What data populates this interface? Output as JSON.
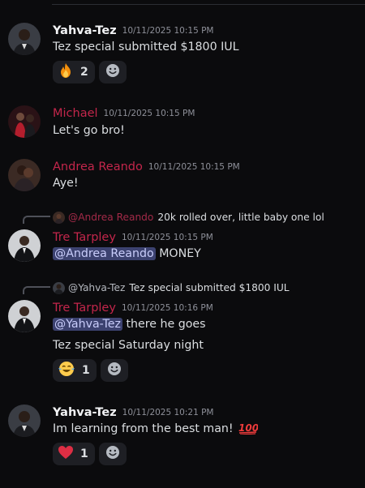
{
  "messages": [
    {
      "author": "Yahva-Tez",
      "timestamp": "10/11/2025 10:15 PM",
      "text": "Tez special submitted $1800 IUL",
      "reaction": {
        "emoji": "fire",
        "count": "2"
      }
    },
    {
      "author": "Michael",
      "timestamp": "10/11/2025 10:15 PM",
      "text": "Let's go bro!"
    },
    {
      "author": "Andrea Reando",
      "timestamp": "10/11/2025 10:15 PM",
      "text": "Aye!"
    },
    {
      "reply_to": {
        "author": "@Andrea Reando",
        "text": "20k rolled over, little baby one lol"
      },
      "author": "Tre Tarpley",
      "timestamp": "10/11/2025 10:15 PM",
      "mention": "@Andrea Reando",
      "text": "MONEY"
    },
    {
      "reply_to": {
        "author": "@Yahva-Tez",
        "text": "Tez special submitted $1800 IUL"
      },
      "author": "Tre Tarpley",
      "timestamp": "10/11/2025 10:16 PM",
      "mention": "@Yahva-Tez",
      "text": "there he goes",
      "text2": "Tez special Saturday night",
      "reaction": {
        "emoji": "face-with-tears-of-joy",
        "count": "1"
      }
    },
    {
      "author": "Yahva-Tez",
      "timestamp": "10/11/2025 10:21 PM",
      "text": "Im learning from the best man!",
      "reaction": {
        "emoji": "red-heart",
        "count": "1"
      }
    }
  ],
  "colors": {
    "background": "#0b0b0d",
    "username_red": "#c3264b",
    "mention_bg": "#3c4270",
    "mention_text": "#c9cdfb"
  }
}
